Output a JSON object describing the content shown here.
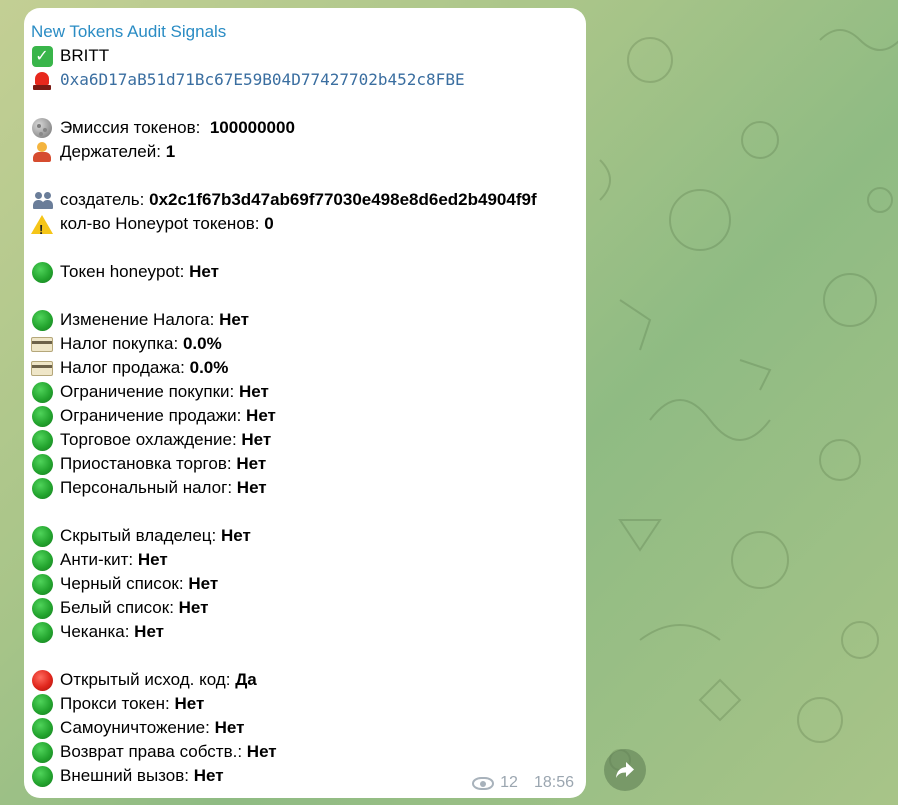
{
  "message": {
    "sender": "New Tokens Audit Signals",
    "token_name": "BRITT",
    "contract_address": "0xa6D17aB51d71Bc67E59B04D77427702b452c8FBE",
    "emission": {
      "label": "Эмиссия токенов:",
      "value": "100000000"
    },
    "holders": {
      "label": "Держателей:",
      "value": "1"
    },
    "creator": {
      "label": "создатель:",
      "value": "0x2c1f67b3d47ab69f77030e498e8d6ed2b4904f9f"
    },
    "honeypot_count": {
      "label": "кол-во Honeypot токенов:",
      "value": "0"
    },
    "honeypot": {
      "label": "Токен honeypot:",
      "value": "Нет",
      "status": "green"
    },
    "tax_group": [
      {
        "label": "Изменение Налога:",
        "value": "Нет",
        "icon": "green"
      },
      {
        "label": "Налог покупка:",
        "value": "0.0%",
        "icon": "card"
      },
      {
        "label": "Налог продажа:",
        "value": "0.0%",
        "icon": "card"
      },
      {
        "label": "Ограничение покупки:",
        "value": "Нет",
        "icon": "green"
      },
      {
        "label": "Ограничение продажи:",
        "value": "Нет",
        "icon": "green"
      },
      {
        "label": "Торговое охлаждение:",
        "value": "Нет",
        "icon": "green"
      },
      {
        "label": "Приостановка торгов:",
        "value": "Нет",
        "icon": "green"
      },
      {
        "label": "Персональный налог:",
        "value": "Нет",
        "icon": "green"
      }
    ],
    "owner_group": [
      {
        "label": "Скрытый владелец:",
        "value": "Нет",
        "icon": "green"
      },
      {
        "label": "Анти-кит:",
        "value": "Нет",
        "icon": "green"
      },
      {
        "label": "Черный список:",
        "value": "Нет",
        "icon": "green"
      },
      {
        "label": "Белый список:",
        "value": "Нет",
        "icon": "green"
      },
      {
        "label": "Чеканка:",
        "value": "Нет",
        "icon": "green"
      }
    ],
    "code_group": [
      {
        "label": "Открытый исход. код:",
        "value": "Да",
        "icon": "red"
      },
      {
        "label": "Прокси токен:",
        "value": "Нет",
        "icon": "green"
      },
      {
        "label": "Самоуничтожение:",
        "value": "Нет",
        "icon": "green"
      },
      {
        "label": "Возврат права собств.:",
        "value": "Нет",
        "icon": "green"
      },
      {
        "label": "Внешний вызов:",
        "value": "Нет",
        "icon": "green"
      }
    ],
    "views": "12",
    "time": "18:56"
  },
  "colors": {
    "sender": "#2a8cc4",
    "green_status": "#24a52f",
    "red_status": "#e0261c",
    "address_link": "#3a6ea0"
  }
}
